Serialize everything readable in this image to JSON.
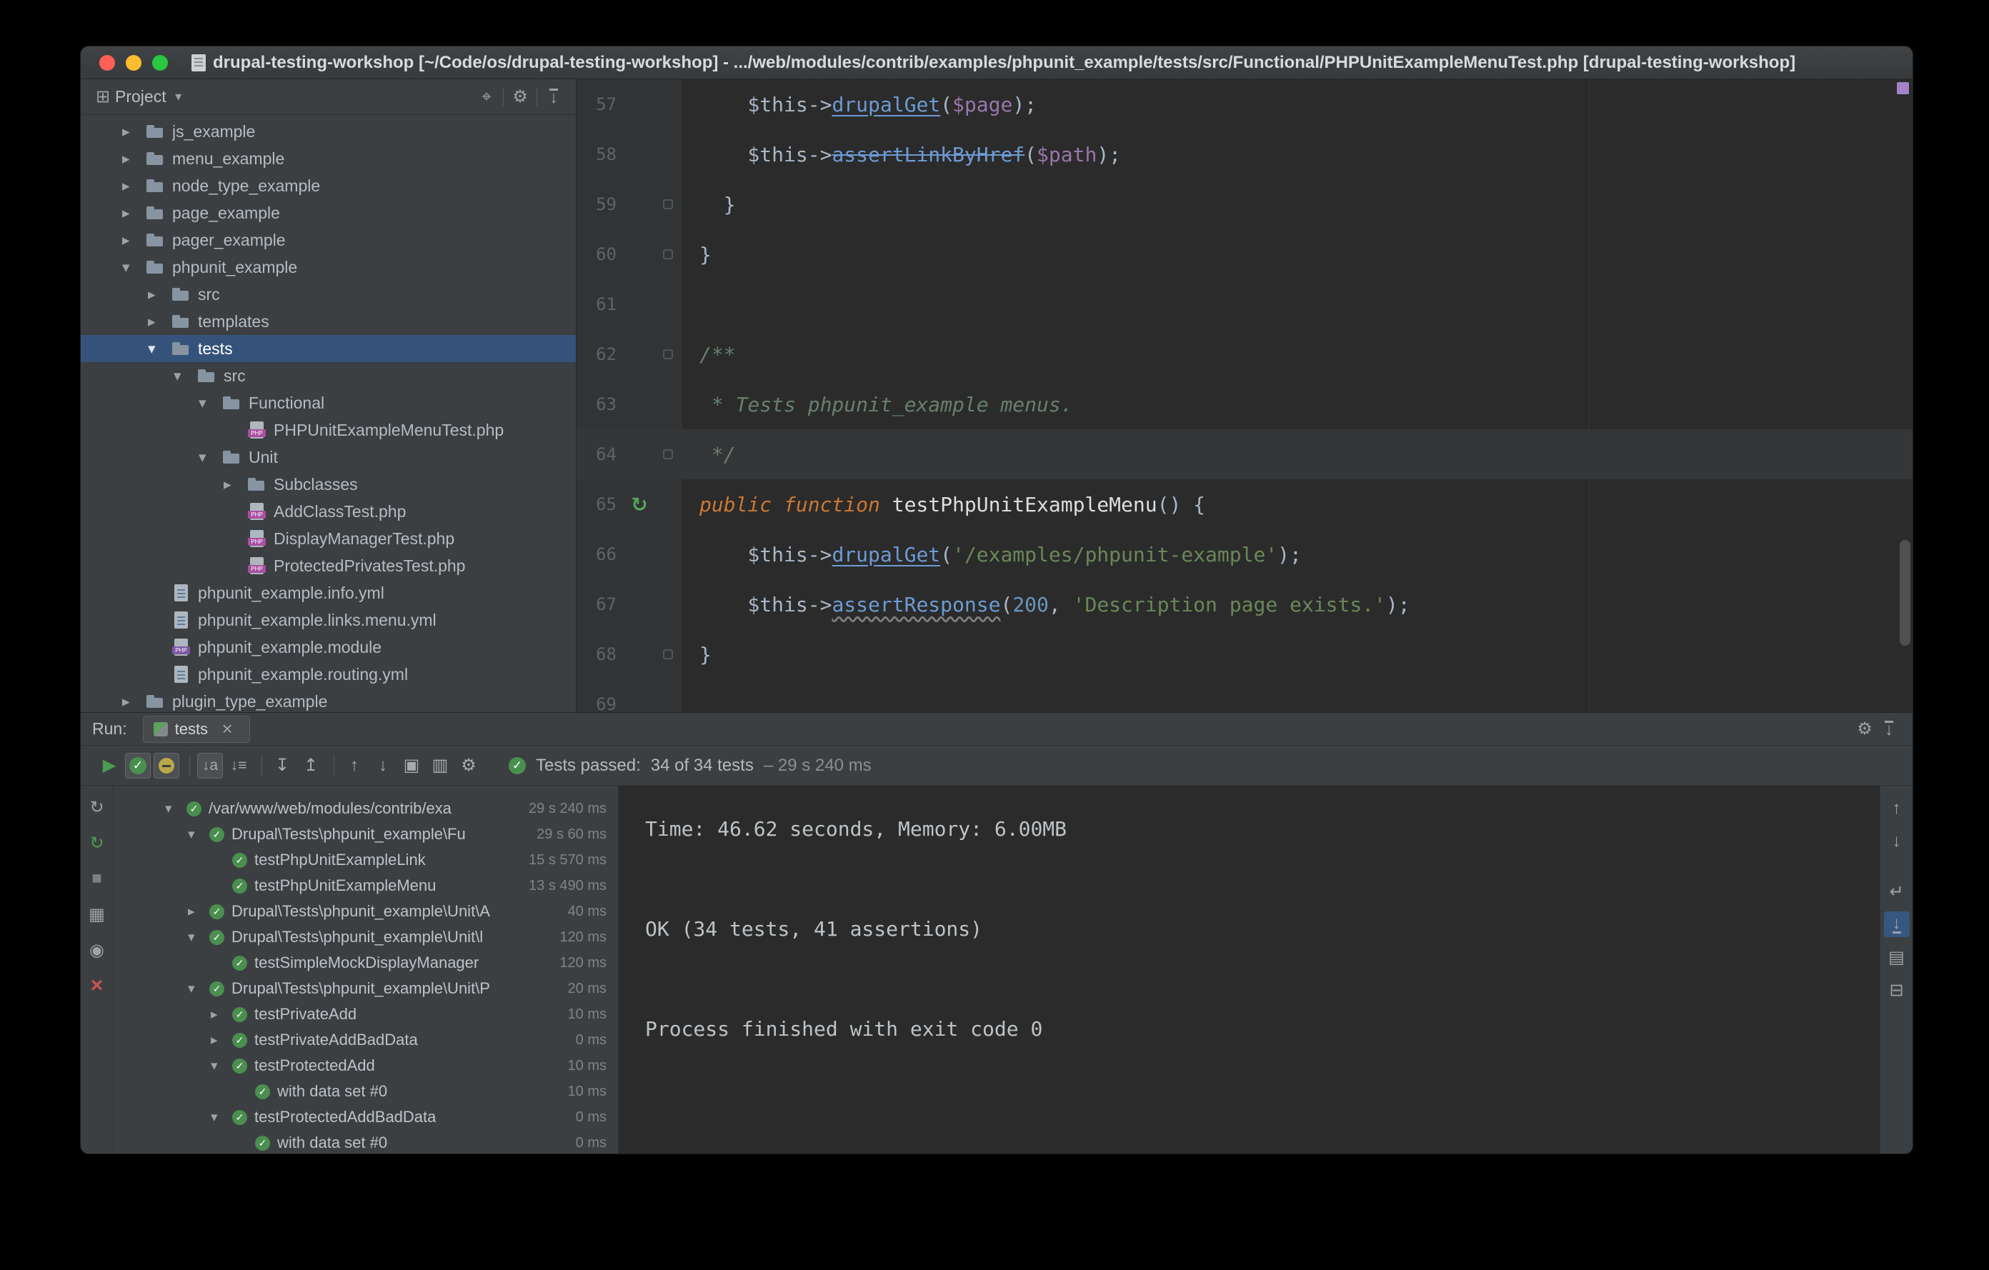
{
  "titlebar": {
    "title": "drupal-testing-workshop [~/Code/os/drupal-testing-workshop] - .../web/modules/contrib/examples/phpunit_example/tests/src/Functional/PHPUnitExampleMenuTest.php [drupal-testing-workshop]"
  },
  "project": {
    "tool_label": "Project",
    "items": [
      {
        "label": "js_example"
      },
      {
        "label": "menu_example"
      },
      {
        "label": "node_type_example"
      },
      {
        "label": "page_example"
      },
      {
        "label": "pager_example"
      },
      {
        "label": "phpunit_example"
      },
      {
        "label": "src"
      },
      {
        "label": "templates"
      },
      {
        "label": "tests"
      },
      {
        "label": "src"
      },
      {
        "label": "Functional"
      },
      {
        "label": "PHPUnitExampleMenuTest.php"
      },
      {
        "label": "Unit"
      },
      {
        "label": "Subclasses"
      },
      {
        "label": "AddClassTest.php"
      },
      {
        "label": "DisplayManagerTest.php"
      },
      {
        "label": "ProtectedPrivatesTest.php"
      },
      {
        "label": "phpunit_example.info.yml"
      },
      {
        "label": "phpunit_example.links.menu.yml"
      },
      {
        "label": "phpunit_example.module"
      },
      {
        "label": "phpunit_example.routing.yml"
      },
      {
        "label": "plugin_type_example"
      }
    ]
  },
  "editor": {
    "lines": [
      {
        "num": "57",
        "t0": "    $this->",
        "t1": "drupalGet",
        "t2": "(",
        "t3": "$page",
        "t4": ");"
      },
      {
        "num": "58",
        "t0": "    $this->",
        "t1": "assertLinkByHref",
        "t2": "(",
        "t3": "$path",
        "t4": ");"
      },
      {
        "num": "59",
        "t0": "  }"
      },
      {
        "num": "60",
        "t0": "}"
      },
      {
        "num": "61",
        "t0": ""
      },
      {
        "num": "62",
        "t0": "/**"
      },
      {
        "num": "63",
        "t0": " * Tests phpunit_example menus."
      },
      {
        "num": "64",
        "t0": " */"
      },
      {
        "num": "65",
        "t0": "public function ",
        "t1": "testPhpUnitExampleMenu",
        "t2": "() {"
      },
      {
        "num": "66",
        "t0": "    $this->",
        "t1": "drupalGet",
        "t2": "(",
        "t3": "'/examples/phpunit-example'",
        "t4": ");"
      },
      {
        "num": "67",
        "t0": "    $this->",
        "t1": "assertResponse",
        "t2": "(",
        "t3": "200",
        "t4": ", ",
        "t5": "'Description page exists.'",
        "t6": ");"
      },
      {
        "num": "68",
        "t0": "}"
      },
      {
        "num": "69",
        "t0": ""
      }
    ]
  },
  "run": {
    "label": "Run:",
    "tab_title": "tests",
    "status": {
      "label": "Tests passed:",
      "counts": "34 of 34 tests",
      "duration": "– 29 s 240 ms"
    },
    "tree": [
      {
        "label": "/var/www/web/modules/contrib/exa",
        "time": "29 s 240 ms"
      },
      {
        "label": "Drupal\\Tests\\phpunit_example\\Fu",
        "time": "29 s 60 ms"
      },
      {
        "label": "testPhpUnitExampleLink",
        "time": "15 s 570 ms"
      },
      {
        "label": "testPhpUnitExampleMenu",
        "time": "13 s 490 ms"
      },
      {
        "label": "Drupal\\Tests\\phpunit_example\\Unit\\A",
        "time": "40 ms"
      },
      {
        "label": "Drupal\\Tests\\phpunit_example\\Unit\\l",
        "time": "120 ms"
      },
      {
        "label": "testSimpleMockDisplayManager",
        "time": "120 ms"
      },
      {
        "label": "Drupal\\Tests\\phpunit_example\\Unit\\P",
        "time": "20 ms"
      },
      {
        "label": "testPrivateAdd",
        "time": "10 ms"
      },
      {
        "label": "testPrivateAddBadData",
        "time": "0 ms"
      },
      {
        "label": "testProtectedAdd",
        "time": "10 ms"
      },
      {
        "label": "with data set #0",
        "time": "10 ms"
      },
      {
        "label": "testProtectedAddBadData",
        "time": "0 ms"
      },
      {
        "label": "with data set #0",
        "time": "0 ms"
      }
    ],
    "console": [
      "Time: 46.62 seconds, Memory: 6.00MB",
      "OK (34 tests, 41 assertions)",
      "Process finished with exit code 0"
    ]
  }
}
